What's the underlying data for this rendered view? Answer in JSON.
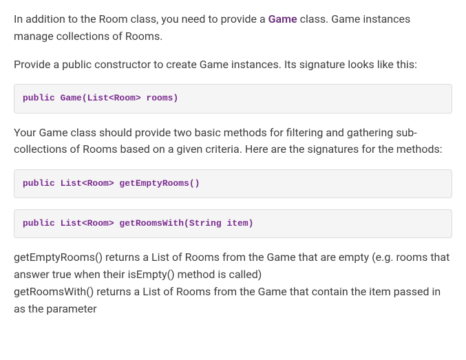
{
  "paragraphs": {
    "p1_prefix": "In addition to the Room class, you need to provide a ",
    "p1_keyword": "Game",
    "p1_suffix": " class. Game instances manage collections of Rooms.",
    "p2": "Provide a public constructor to create Game instances. Its signature looks like this:",
    "p3": "Your Game class should provide two basic methods for filtering and gathering sub-collections of Rooms based on a given criteria. Here are the signatures for the methods:",
    "p4_line1": "getEmptyRooms() returns a List of Rooms from the Game that are empty (e.g. rooms that answer true when their isEmpty() method is called)",
    "p4_line2": "getRoomsWith() returns a List of Rooms from the Game that contain the item passed in as the parameter"
  },
  "code": {
    "c1": "public Game(List<Room> rooms)",
    "c2": "public List<Room> getEmptyRooms()",
    "c3": "public List<Room> getRoomsWith(String item)"
  }
}
